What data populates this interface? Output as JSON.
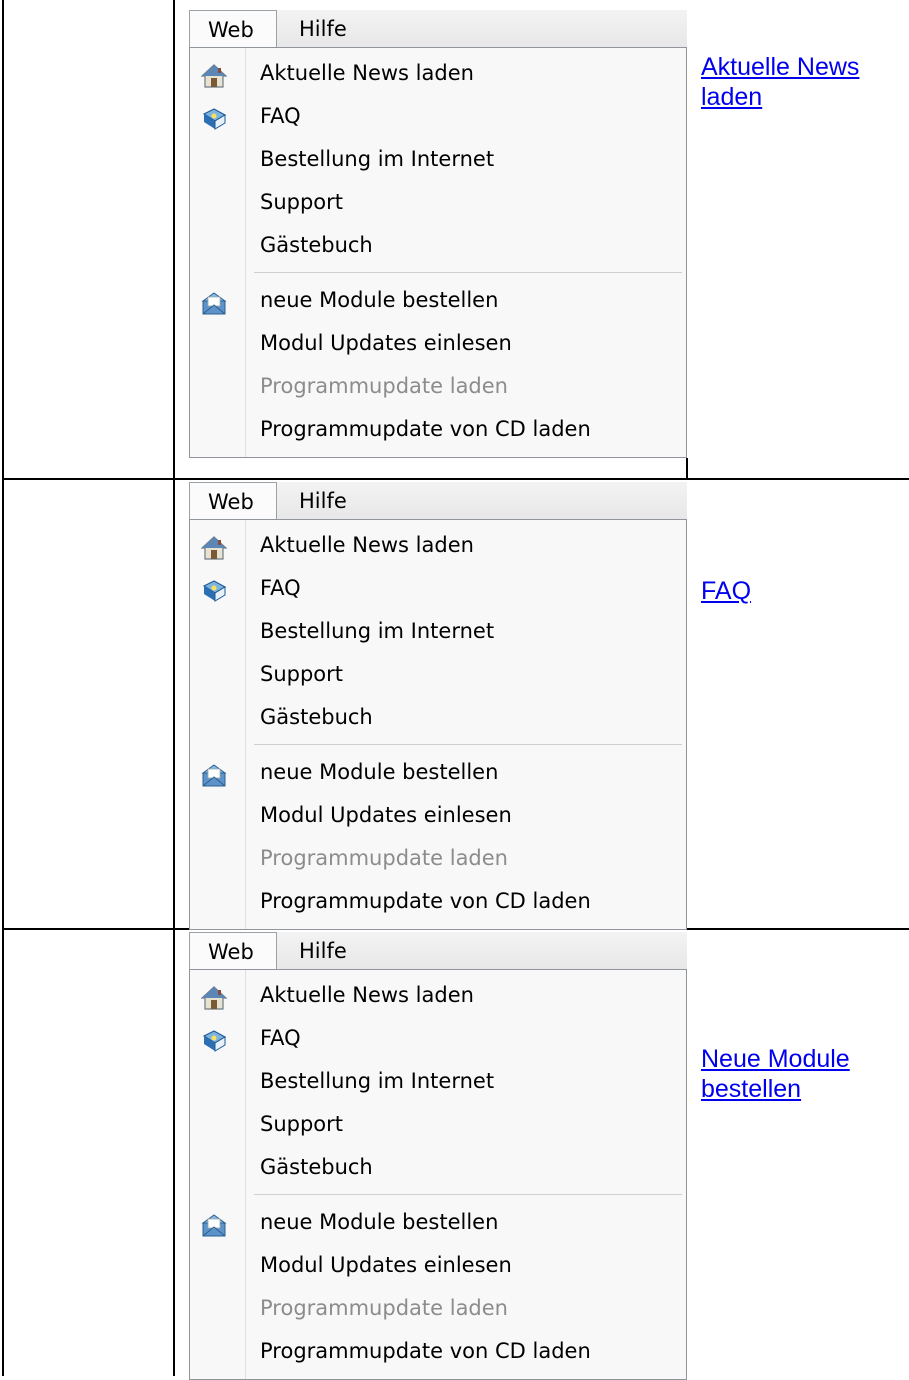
{
  "menu": {
    "tabs": [
      "Web",
      "Hilfe"
    ],
    "items": [
      {
        "label": "Aktuelle News laden",
        "icon": "house-icon",
        "disabled": false
      },
      {
        "label": "FAQ",
        "icon": "book-icon",
        "disabled": false
      },
      {
        "label": "Bestellung im Internet",
        "icon": "",
        "disabled": false
      },
      {
        "label": "Support",
        "icon": "",
        "disabled": false
      },
      {
        "label": "Gästebuch",
        "icon": "",
        "disabled": false
      },
      {
        "separator": true
      },
      {
        "label": "neue Module bestellen",
        "icon": "mail-icon",
        "disabled": false
      },
      {
        "label": "Modul Updates einlesen",
        "icon": "",
        "disabled": false
      },
      {
        "label": "Programmupdate laden",
        "icon": "",
        "disabled": true
      },
      {
        "label": "Programmupdate von CD laden",
        "icon": "",
        "disabled": false
      }
    ]
  },
  "rows": [
    {
      "link_line1": "Aktuelle News ",
      "link_line2": "laden"
    },
    {
      "link_line1": "FAQ",
      "link_line2": ""
    },
    {
      "link_line1": "Neue Module ",
      "link_line2": "bestellen"
    }
  ],
  "colors": {
    "link": "#0000ee",
    "disabled_text": "#8c8c8c",
    "menu_bg": "#f8f8f8"
  }
}
